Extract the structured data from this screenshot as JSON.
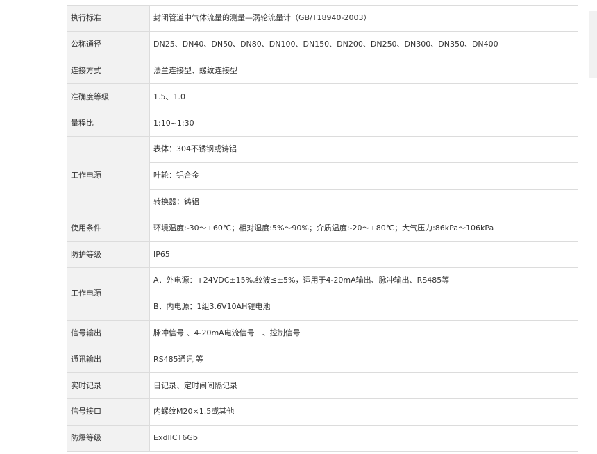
{
  "spec_table": {
    "rows": [
      {
        "label": "执行标准",
        "values": [
          "封闭管道中气体流量的测量—涡轮流量计（GB/T18940-2003）"
        ]
      },
      {
        "label": "公称通径",
        "values": [
          "DN25、DN40、DN50、DN80、DN100、DN150、DN200、DN250、DN300、DN350、DN400"
        ]
      },
      {
        "label": "连接方式",
        "values": [
          "法兰连接型、螺纹连接型"
        ]
      },
      {
        "label": "准确度等级",
        "values": [
          "1.5、1.0"
        ]
      },
      {
        "label": "量程比",
        "values": [
          "1:10~1:30"
        ]
      },
      {
        "label": "工作电源",
        "values": [
          "表体：304不锈钢或铸铝",
          "叶轮：铝合金",
          "转换器：铸铝"
        ]
      },
      {
        "label": "使用条件",
        "values": [
          "环境温度:-30～+60℃；相对湿度:5%～90%；介质温度:-20～+80℃；大气压力:86kPa～106kPa"
        ]
      },
      {
        "label": "防护等级",
        "values": [
          "IP65"
        ]
      },
      {
        "label": "工作电源",
        "values": [
          "A．外电源：+24VDC±15%,纹波≤±5%，适用于4-20mA输出、脉冲输出、RS485等",
          "B．内电源：1组3.6V10AH锂电池"
        ]
      },
      {
        "label": "信号输出",
        "values": [
          "脉冲信号 、4-20mA电流信号　、控制信号"
        ]
      },
      {
        "label": "通讯输出",
        "values": [
          "RS485通讯 等"
        ]
      },
      {
        "label": "实时记录",
        "values": [
          "日记录、定时间间隔记录"
        ]
      },
      {
        "label": "信号接口",
        "values": [
          "内螺纹M20×1.5或其他"
        ]
      },
      {
        "label": "防爆等级",
        "values": [
          "ExdIICT6Gb"
        ]
      }
    ]
  }
}
